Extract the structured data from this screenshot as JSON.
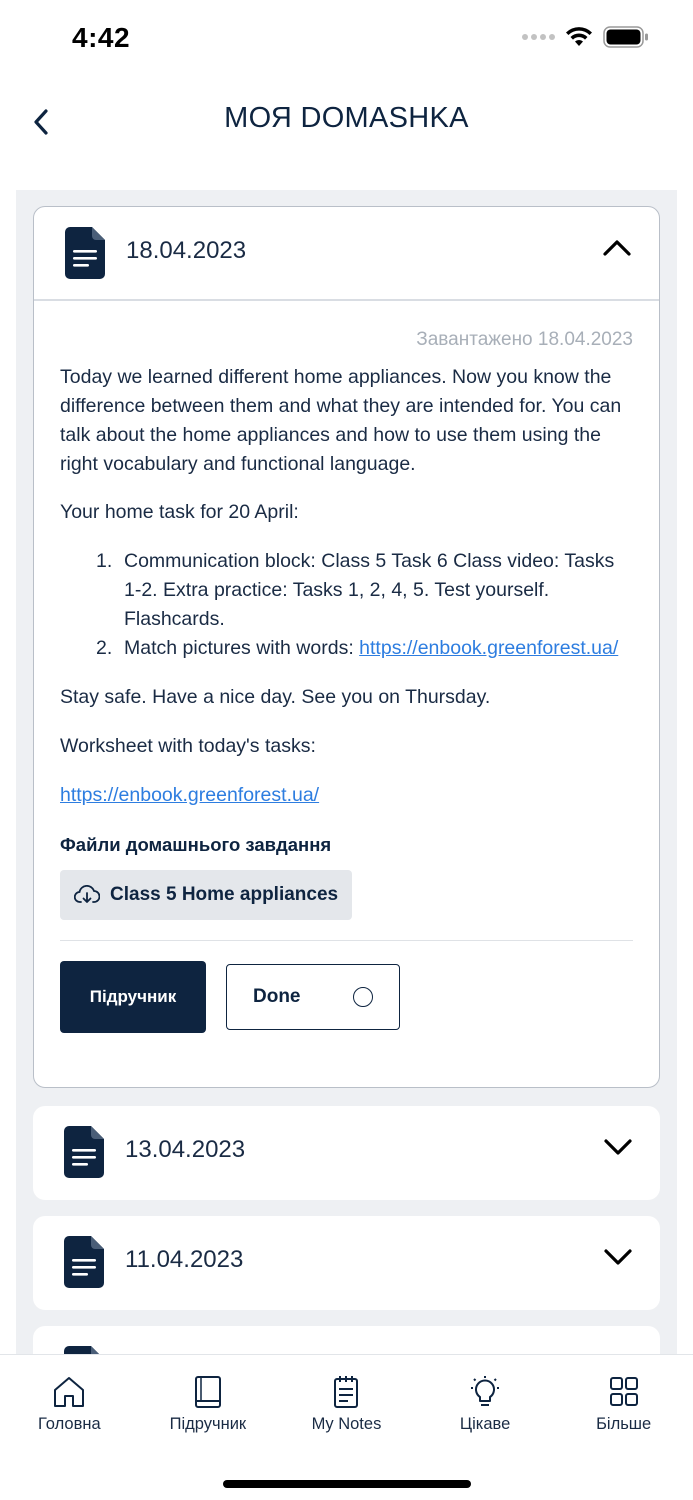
{
  "status_bar": {
    "time": "4:42"
  },
  "header": {
    "title": "МОЯ DOMASHKA"
  },
  "homework": [
    {
      "date": "18.04.2023",
      "expanded": true,
      "uploaded": "Завантажено 18.04.2023",
      "intro": "Today we learned different home appliances. Now you know the difference between them and what they are intended for. You can talk about the home appliances and how to use them using the right vocabulary and functional language.",
      "task_heading": "Your home task for 20 April:",
      "tasks": [
        {
          "num": "1.",
          "text": "Communication block: Class 5 Task 6 Class video: Tasks 1-2. Extra practice: Tasks 1, 2, 4, 5. Test yourself. Flashcards."
        },
        {
          "num": "2.",
          "text": "Match pictures with words: ",
          "link": "https://enbook.greenforest.ua/"
        }
      ],
      "closing": "Stay safe. Have a nice day. See you on Thursday.",
      "worksheet_label": "Worksheet with today's tasks:",
      "worksheet_link": "https://enbook.greenforest.ua/",
      "files_title": "Файли домашнього завдання",
      "file_name": "Class 5 Home appliances",
      "textbook_button": "Підручник",
      "done_button": "Done"
    },
    {
      "date": "13.04.2023",
      "expanded": false
    },
    {
      "date": "11.04.2023",
      "expanded": false
    }
  ],
  "bottom_nav": [
    {
      "label": "Головна",
      "icon": "home-icon"
    },
    {
      "label": "Підручник",
      "icon": "book-icon"
    },
    {
      "label": "My Notes",
      "icon": "notes-icon"
    },
    {
      "label": "Цікаве",
      "icon": "lightbulb-icon"
    },
    {
      "label": "Більше",
      "icon": "grid-icon"
    }
  ],
  "colors": {
    "primary": "#0e2440",
    "link": "#2d7de0",
    "background": "#eef0f3"
  }
}
